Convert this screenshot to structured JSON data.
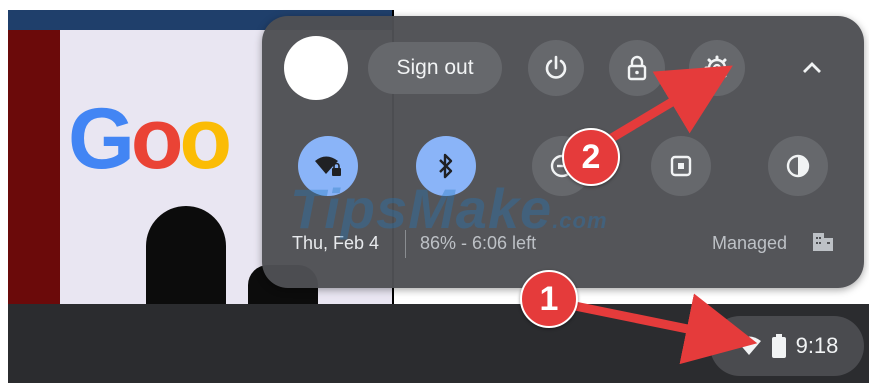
{
  "wallpaper": {
    "logo_text": "Goo"
  },
  "quick_settings": {
    "sign_out_label": "Sign out",
    "date": "Thu, Feb 4",
    "battery": "86% - 6:06 left",
    "managed_label": "Managed"
  },
  "shelf": {
    "time": "9:18"
  },
  "watermark": {
    "text": "TipsMake",
    "suffix": ".com"
  },
  "annotations": {
    "step1": "1",
    "step2": "2"
  },
  "colors": {
    "panel": "#4e5054",
    "button": "#66686c",
    "active_blue": "#8ab4f8",
    "annotation_red": "#e53b3b",
    "shelf": "#2b2c2f"
  },
  "icons": [
    "power-icon",
    "lock-icon",
    "settings-gear-icon",
    "collapse-chevron-icon",
    "wifi-locked-icon",
    "bluetooth-icon",
    "dnd-icon",
    "screen-capture-icon",
    "night-light-icon",
    "managed-building-icon",
    "wifi-icon",
    "battery-icon"
  ]
}
